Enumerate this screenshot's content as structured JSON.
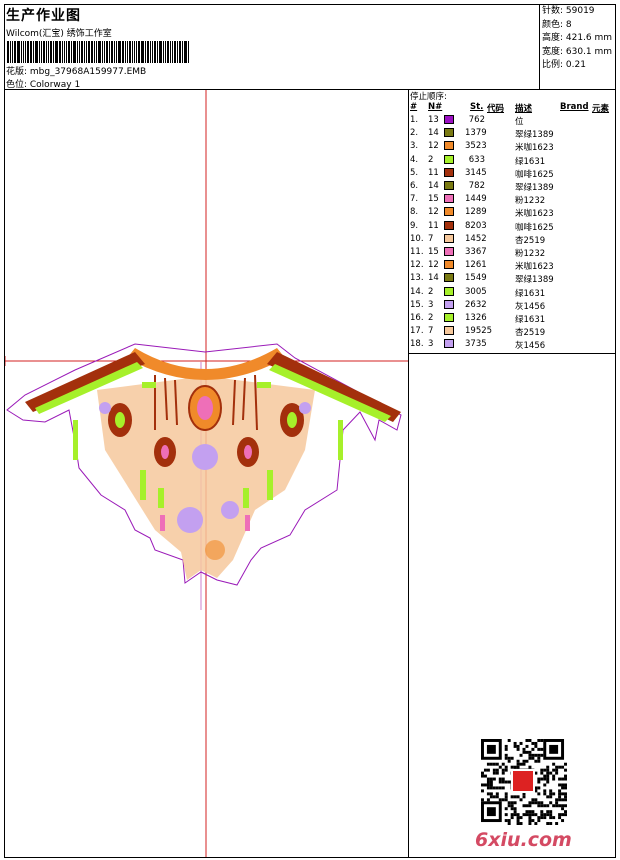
{
  "header": {
    "title": "生产作业图",
    "subtitle": "Wilcom(汇宝) 绣饰工作室",
    "file_label": "花版: mbg_37968A159977.EMB",
    "colorway_label": "色位: Colorway 1"
  },
  "stats": {
    "stitches": "针数: 59019",
    "colors": "颜色: 8",
    "height": "高度: 421.6 mm",
    "width": "宽度: 630.1 mm",
    "scale": "比例: 0.21"
  },
  "legend": {
    "caption": "停止顺序:",
    "columns": [
      "#",
      "N#",
      "St.",
      "代码",
      "描述",
      "Brand",
      "元素"
    ],
    "rows": [
      {
        "idx": "1.",
        "n": "13",
        "color": "#9b10c2",
        "st": "762",
        "desc": "位"
      },
      {
        "idx": "2.",
        "n": "14",
        "color": "#7a7a12",
        "st": "1379",
        "desc": "翠绿1389"
      },
      {
        "idx": "3.",
        "n": "12",
        "color": "#f08a2a",
        "st": "3523",
        "desc": "米咖1623"
      },
      {
        "idx": "4.",
        "n": "2",
        "color": "#a6f02a",
        "st": "633",
        "desc": "绿1631"
      },
      {
        "idx": "5.",
        "n": "11",
        "color": "#a3300c",
        "st": "3145",
        "desc": "咖啡1625"
      },
      {
        "idx": "6.",
        "n": "14",
        "color": "#7a7a12",
        "st": "782",
        "desc": "翠绿1389"
      },
      {
        "idx": "7.",
        "n": "15",
        "color": "#ee6fb8",
        "st": "1449",
        "desc": "粉1232"
      },
      {
        "idx": "8.",
        "n": "12",
        "color": "#f08a2a",
        "st": "1289",
        "desc": "米咖1623"
      },
      {
        "idx": "9.",
        "n": "11",
        "color": "#a3300c",
        "st": "8203",
        "desc": "咖啡1625"
      },
      {
        "idx": "10.",
        "n": "7",
        "color": "#f6c89c",
        "st": "1452",
        "desc": "杏2519"
      },
      {
        "idx": "11.",
        "n": "15",
        "color": "#ee6fb8",
        "st": "3367",
        "desc": "粉1232"
      },
      {
        "idx": "12.",
        "n": "12",
        "color": "#f08a2a",
        "st": "1261",
        "desc": "米咖1623"
      },
      {
        "idx": "13.",
        "n": "14",
        "color": "#7a7a12",
        "st": "1549",
        "desc": "翠绿1389"
      },
      {
        "idx": "14.",
        "n": "2",
        "color": "#a6f02a",
        "st": "3005",
        "desc": "绿1631"
      },
      {
        "idx": "15.",
        "n": "3",
        "color": "#c3a0f0",
        "st": "2632",
        "desc": "灰1456"
      },
      {
        "idx": "16.",
        "n": "2",
        "color": "#a6f02a",
        "st": "1326",
        "desc": "绿1631"
      },
      {
        "idx": "17.",
        "n": "7",
        "color": "#f6c89c",
        "st": "19525",
        "desc": "杏2519"
      },
      {
        "idx": "18.",
        "n": "3",
        "color": "#c3a0f0",
        "st": "3735",
        "desc": "灰1456"
      }
    ]
  },
  "watermark": "6xiu.com",
  "qr_stamp": "QR code"
}
